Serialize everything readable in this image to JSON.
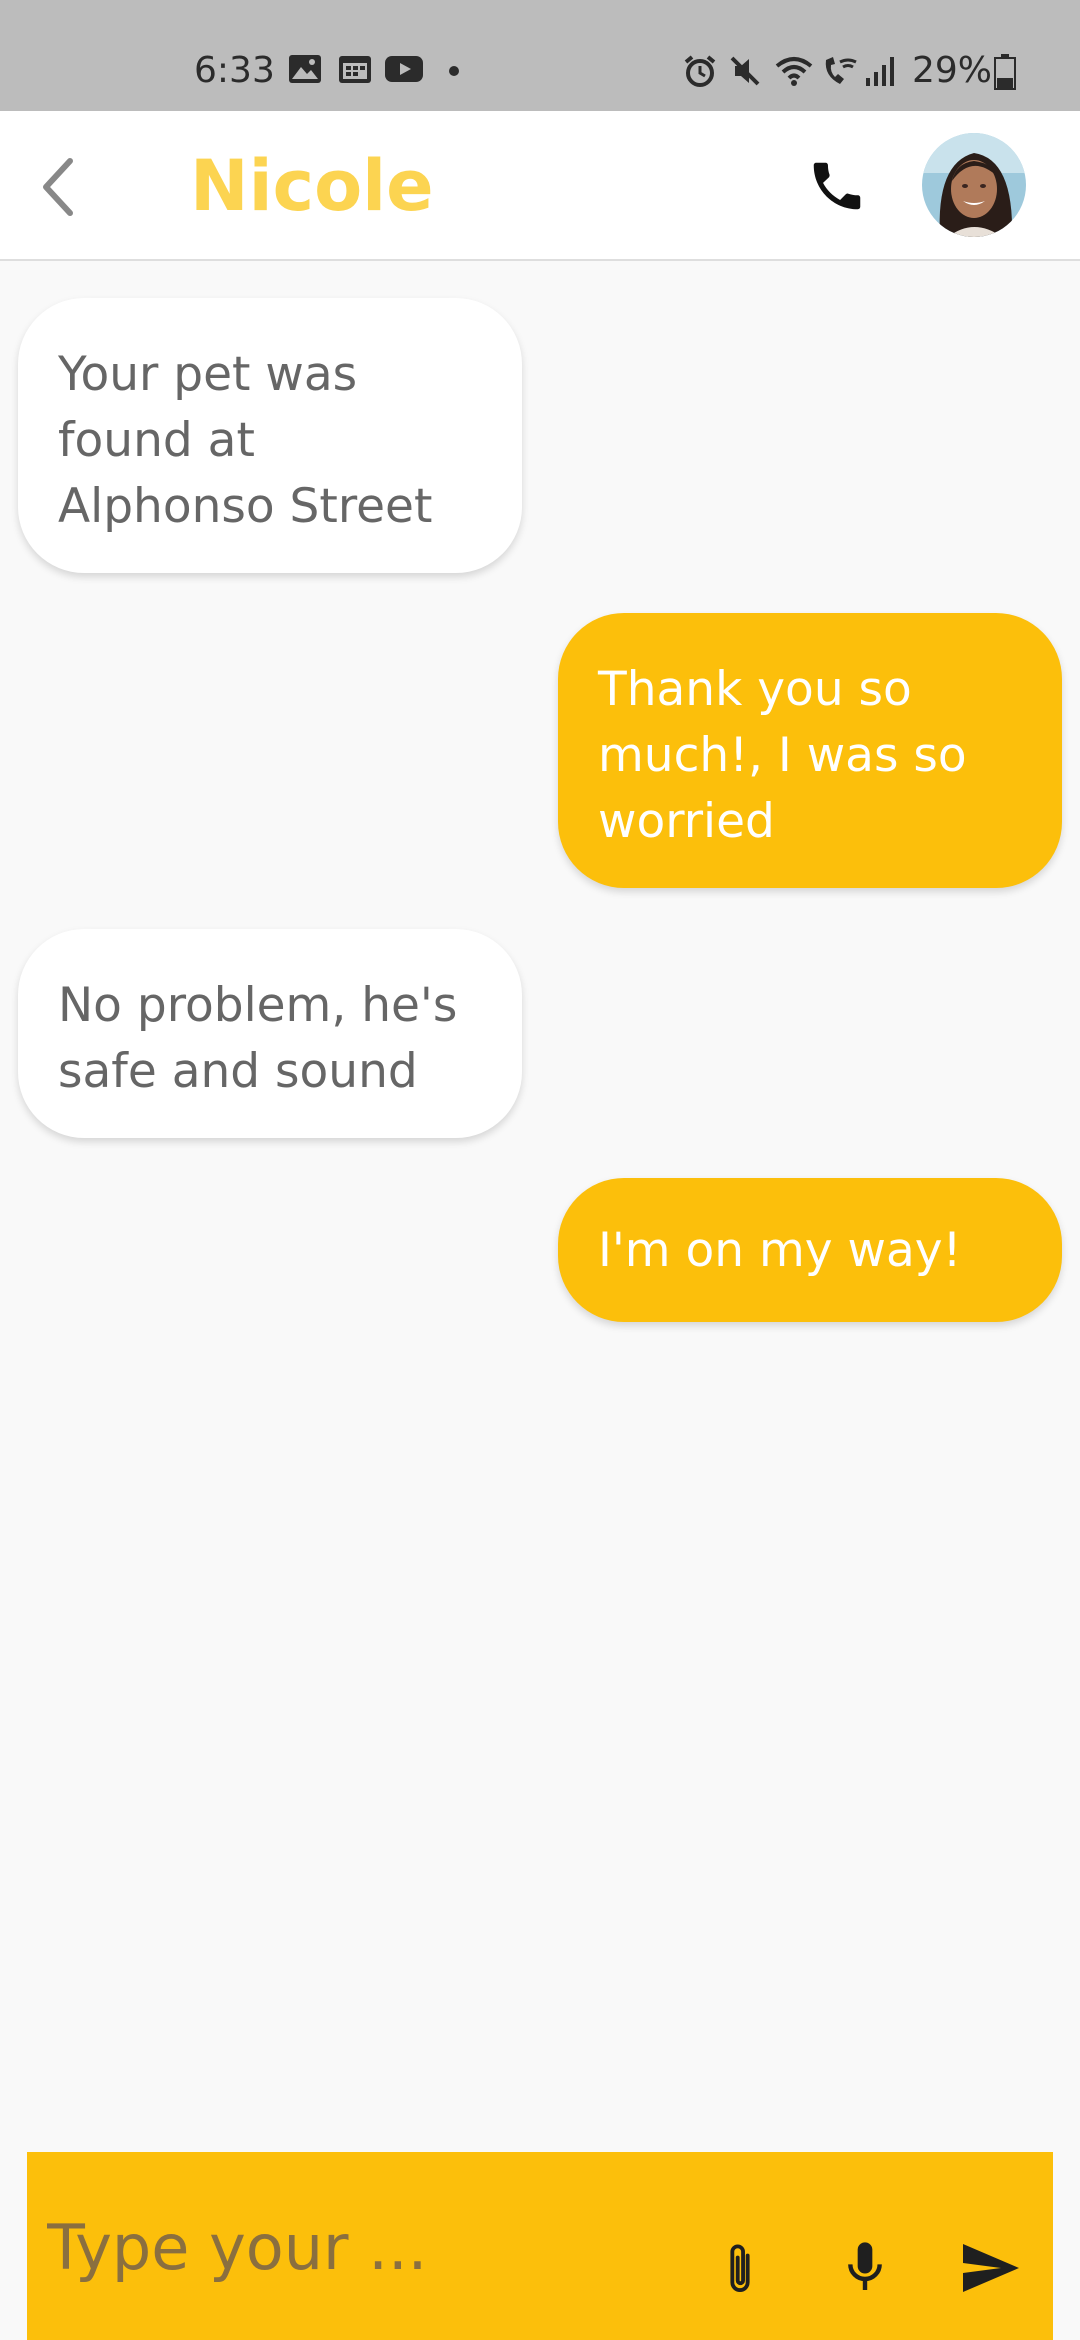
{
  "status_bar": {
    "time": "6:33",
    "battery": "29%",
    "icons": [
      "gallery-icon",
      "calendar-icon",
      "youtube-icon",
      "dot-icon",
      "alarm-icon",
      "mute-icon",
      "wifi-icon",
      "wifi-calling-icon",
      "signal-icon",
      "battery-icon"
    ]
  },
  "header": {
    "title": "Nicole",
    "back_icon": "chevron-left-icon",
    "call_icon": "phone-icon",
    "avatar": "contact-avatar"
  },
  "messages": [
    {
      "direction": "incoming",
      "text": "Your pet was found at Alphonso Street"
    },
    {
      "direction": "outgoing",
      "text": "Thank you so much!, I was so worried"
    },
    {
      "direction": "incoming",
      "text": "No problem, he's safe and sound"
    },
    {
      "direction": "outgoing",
      "text": "I'm on my way!"
    }
  ],
  "composer": {
    "placeholder": "Type your ...",
    "value": "",
    "attach_icon": "paperclip-icon",
    "mic_icon": "microphone-icon",
    "send_icon": "send-icon"
  },
  "colors": {
    "accent": "#fcbf0b",
    "title": "#fcd451",
    "incoming_bubble": "#ffffff",
    "incoming_text": "#666666",
    "background": "#f9f9f9",
    "status_bar": "#bcbcbc"
  }
}
